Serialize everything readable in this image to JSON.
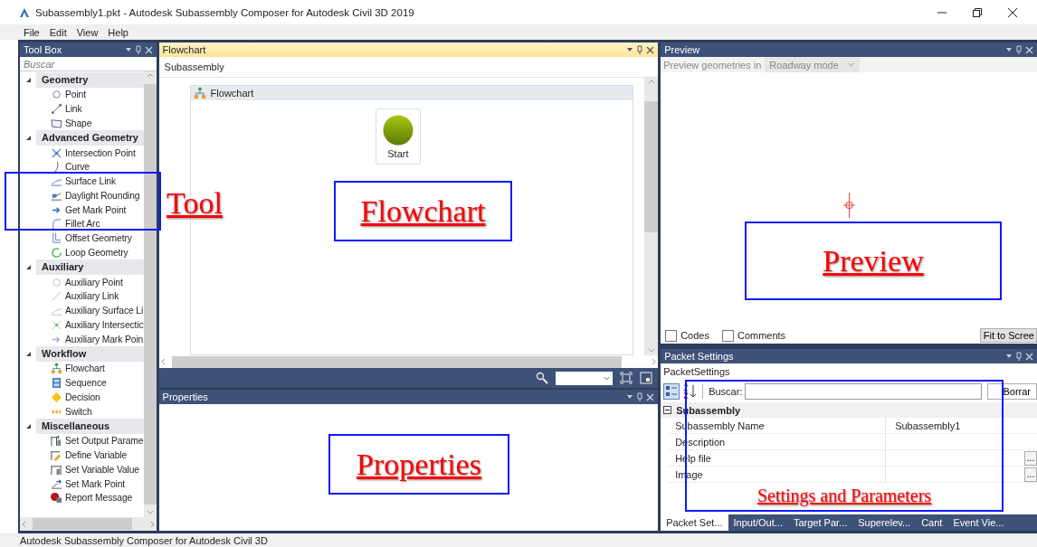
{
  "window": {
    "title": "Subassembly1.pkt - Autodesk Subassembly Composer for Autodesk Civil 3D 2019"
  },
  "menu": [
    "File",
    "Edit",
    "View",
    "Help"
  ],
  "toolbox": {
    "title": "Tool Box",
    "search": {
      "placeholder": "Buscar"
    },
    "groups": [
      {
        "label": "Geometry",
        "expanded": true,
        "items": [
          {
            "label": "Point",
            "kind": "point"
          },
          {
            "label": "Link",
            "kind": "link"
          },
          {
            "label": "Shape",
            "kind": "shape"
          }
        ]
      },
      {
        "label": "Advanced Geometry",
        "expanded": true,
        "items": [
          {
            "label": "Intersection Point",
            "kind": "intersection"
          },
          {
            "label": "Curve",
            "kind": "curve"
          },
          {
            "label": "Surface Link",
            "kind": "surface"
          },
          {
            "label": "Daylight Rounding",
            "kind": "daylight"
          },
          {
            "label": "Get Mark Point",
            "kind": "mark"
          },
          {
            "label": "Fillet Arc",
            "kind": "fillet"
          },
          {
            "label": "Offset Geometry",
            "kind": "offset"
          },
          {
            "label": "Loop Geometry",
            "kind": "loop"
          }
        ]
      },
      {
        "label": "Auxiliary",
        "expanded": true,
        "items": [
          {
            "label": "Auxiliary Point",
            "kind": "aux-point"
          },
          {
            "label": "Auxiliary Link",
            "kind": "aux-link"
          },
          {
            "label": "Auxiliary Surface Li",
            "kind": "aux-surface"
          },
          {
            "label": "Auxiliary Intersectic",
            "kind": "aux-intersection"
          },
          {
            "label": "Auxiliary Mark Poin",
            "kind": "aux-mark"
          }
        ]
      },
      {
        "label": "Workflow",
        "expanded": true,
        "items": [
          {
            "label": "Flowchart",
            "kind": "flowchart"
          },
          {
            "label": "Sequence",
            "kind": "sequence"
          },
          {
            "label": "Decision",
            "kind": "decision"
          },
          {
            "label": "Switch",
            "kind": "switch"
          }
        ]
      },
      {
        "label": "Miscellaneous",
        "expanded": true,
        "items": [
          {
            "label": "Set Output Parame",
            "kind": "output"
          },
          {
            "label": "Define Variable",
            "kind": "define"
          },
          {
            "label": "Set Variable Value",
            "kind": "setvar"
          },
          {
            "label": "Set Mark Point",
            "kind": "setmark"
          },
          {
            "label": "Report Message",
            "kind": "report"
          }
        ]
      }
    ]
  },
  "flowchart": {
    "title": "Flowchart",
    "breadcrumb": "Subassembly",
    "canvas_title": "Flowchart",
    "nodes": [
      {
        "label": "Start"
      }
    ]
  },
  "properties": {
    "title": "Properties"
  },
  "preview": {
    "title": "Preview",
    "mode_label": "Preview geometries in",
    "mode": "Roadway mode",
    "checkboxes": [
      {
        "label": "Codes",
        "checked": false
      },
      {
        "label": "Comments",
        "checked": false
      }
    ],
    "fit_button": "Fit to Scree"
  },
  "packet_settings": {
    "title": "Packet Settings",
    "object": "PacketSettings",
    "search_label": "Buscar:",
    "clear_button": "Borrar",
    "category": {
      "label": "Subassembly",
      "expanded": true
    },
    "rows": [
      {
        "name": "Subassembly Name",
        "value": "Subassembly1"
      },
      {
        "name": "Description"
      },
      {
        "name": "Help file",
        "button": "..."
      },
      {
        "name": "Image",
        "button": "..."
      }
    ],
    "tabs": [
      {
        "label": "Packet Set...",
        "selected": true
      },
      {
        "label": "Input/Out...",
        "selected": false
      },
      {
        "label": "Target Par...",
        "selected": false
      },
      {
        "label": "Superelev...",
        "selected": false
      },
      {
        "label": "Cant",
        "selected": false
      },
      {
        "label": "Event Vie...",
        "selected": false
      }
    ]
  },
  "status_bar": "Autodesk Subassembly Composer for Autodesk Civil 3D",
  "annotations": [
    {
      "text": "Tool"
    },
    {
      "text": "Flowchart"
    },
    {
      "text": "Preview"
    },
    {
      "text": "Properties"
    },
    {
      "text": "Settings and Parameters"
    }
  ]
}
